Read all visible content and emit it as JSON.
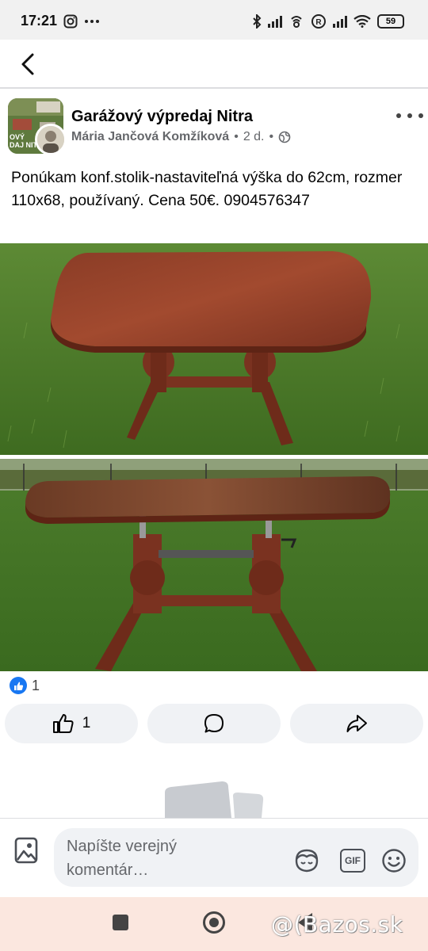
{
  "status_bar": {
    "time": "17:21",
    "battery": "59",
    "icons": [
      "instagram-icon",
      "more-icon",
      "bluetooth-icon",
      "signal-icon",
      "hotspot-icon",
      "data-saver-icon",
      "signal-icon",
      "wifi-icon",
      "battery-icon"
    ]
  },
  "nav": {
    "back_icon": "back-arrow-icon"
  },
  "post": {
    "group_name": "Garážový výpredaj Nitra",
    "author": "Mária Jančová Komžíková",
    "time": "2 d.",
    "separator": "•",
    "privacy_icon": "globe-icon",
    "avatar_text": "OVÝ\nDAJ NITRA",
    "text": "Ponúkam konf.stolik-nastaviteľná výška do 62cm, rozmer 110x68, používaný. Cena 50€. 0904576347",
    "photos": [
      "table-photo-1",
      "table-photo-2"
    ]
  },
  "reactions": {
    "count": "1",
    "like_label": "1",
    "buttons": [
      "like-icon",
      "comment-icon",
      "share-icon"
    ]
  },
  "composer": {
    "placeholder": "Napíšte verejný komentár…",
    "icons": [
      "photo-icon",
      "avatar-sticker-icon",
      "gif-icon",
      "emoji-icon"
    ],
    "gif_label": "GIF"
  },
  "watermark": "@(Bazos.sk",
  "colors": {
    "facebook_blue": "#1877f2",
    "button_bg": "#f0f2f5",
    "meta_text": "#65676b",
    "nav_bar": "#fbe7df"
  }
}
